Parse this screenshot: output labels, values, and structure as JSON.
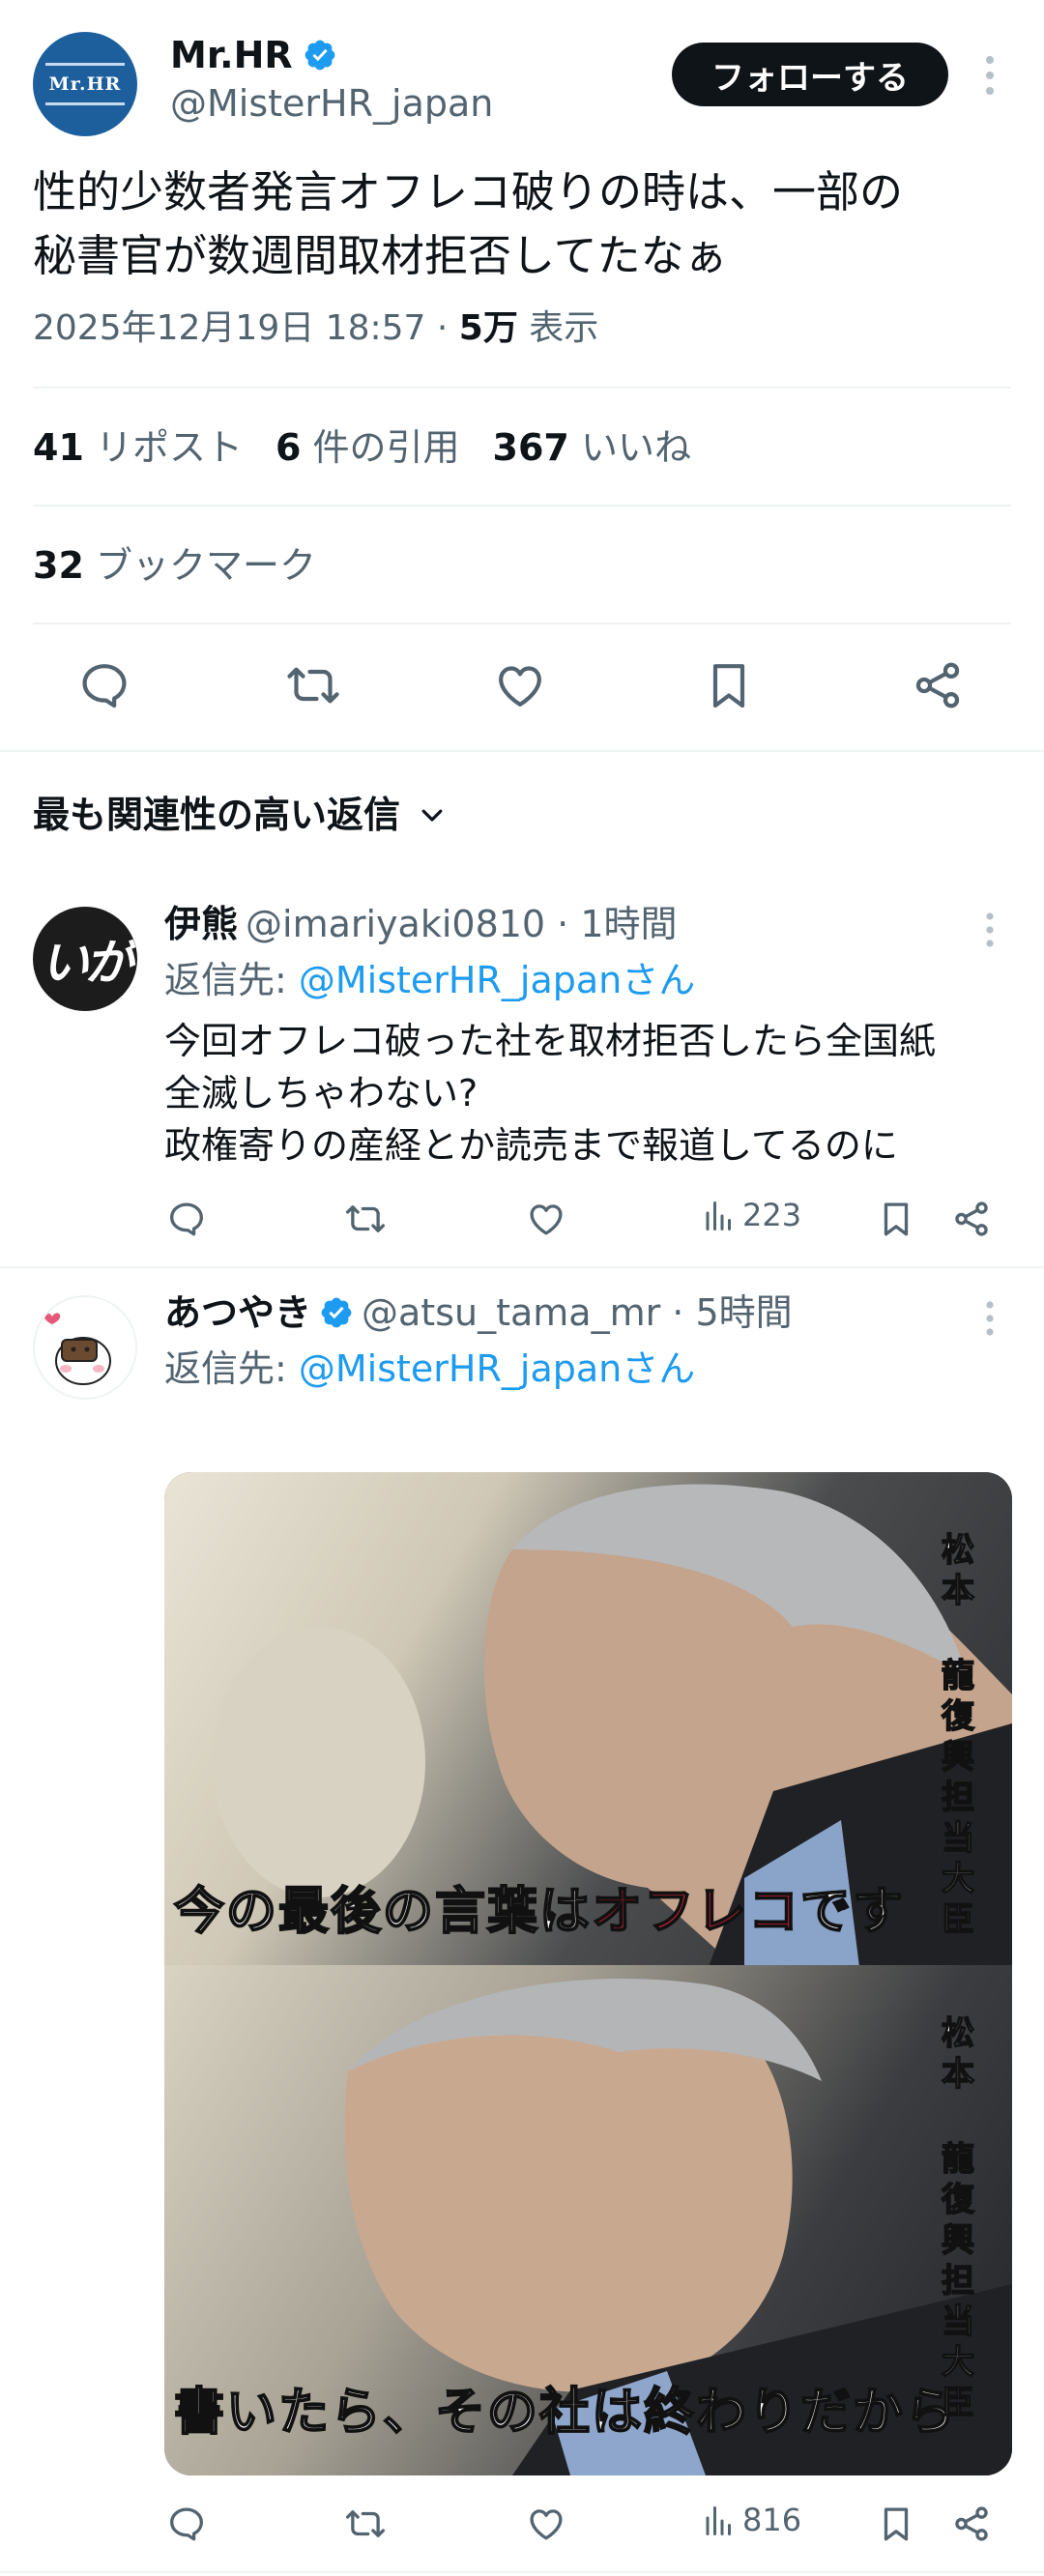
{
  "post": {
    "author_name": "Mr.HR",
    "author_handle": "@MisterHR_japan",
    "avatar_text": "Mr.HR",
    "follow_label": "フォローする",
    "text_line1": "性的少数者発言オフレコ破りの時は、一部の",
    "text_line2": "秘書官が数週間取材拒否してたなぁ",
    "timestamp": "2025年12月19日 18:57 · ",
    "views_count": "5万",
    "views_label": " 表示"
  },
  "stats": {
    "reposts_count": "41",
    "reposts_label": " リポスト",
    "quotes_count": "6",
    "quotes_label": " 件の引用",
    "likes_count": "367",
    "likes_label": " いいね",
    "bookmarks_count": "32",
    "bookmarks_label": " ブックマーク"
  },
  "sort_label": "最も関連性の高い返信",
  "replies": [
    {
      "name": "伊熊",
      "handle": "@imariyaki0810 · 1時間",
      "avatar_text": "いが",
      "reply_prefix": "返信先: ",
      "reply_to": "@MisterHR_japanさん",
      "line1": "今回オフレコ破った社を取材拒否したら全国紙",
      "line2": "全滅しちゃわない?",
      "line3": "政権寄りの産経とか読売まで報道してるのに",
      "views": "223"
    },
    {
      "name": "あつやき",
      "handle": "@atsu_tama_mr · 5時間",
      "reply_prefix": "返信先: ",
      "reply_to": "@MisterHR_japanさん",
      "caption1_a": "今の最後の言葉は",
      "caption1_b": "オフレコ",
      "caption1_c": "です",
      "caption2": "書いたら、その社は終わりだから",
      "vertical_name_1": "松本",
      "vertical_title": "龍復興担当大臣",
      "views": "816"
    }
  ],
  "colors": {
    "accent": "#1d9bf0",
    "text": "#0f1419",
    "secondary": "#536471",
    "caption_red": "#e8213a"
  }
}
